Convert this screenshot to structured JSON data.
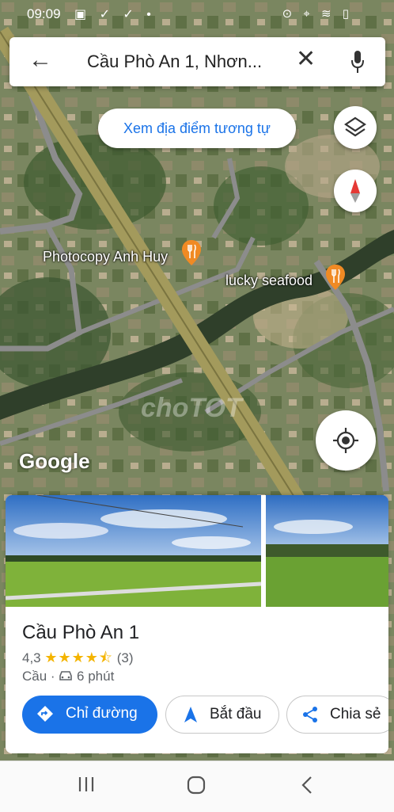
{
  "status_bar": {
    "time": "09:09",
    "left_icons": "▣ ✓ ✓ •",
    "right_icons": "⊙ ⌖ ≋ ▯"
  },
  "search": {
    "query": "Cầu Phò An 1, Nhơn..."
  },
  "map": {
    "similar_places_chip": "Xem địa điểm tương tự",
    "pois": [
      {
        "label": "Photocopy Anh Huy"
      },
      {
        "label": "lucky seafood"
      }
    ],
    "google_logo": "Google",
    "watermark": "choTOT"
  },
  "place": {
    "title": "Cầu Phò An 1",
    "rating": "4,3",
    "stars": "★★★★⯪",
    "review_count": "(3)",
    "category": "Cầu ·",
    "travel_time": "6 phút"
  },
  "actions": {
    "directions": "Chỉ đường",
    "start": "Bắt đầu",
    "share": "Chia sẻ"
  },
  "colors": {
    "accent": "#1a73e8",
    "star": "#f4b400",
    "road": "#a39a5c"
  }
}
